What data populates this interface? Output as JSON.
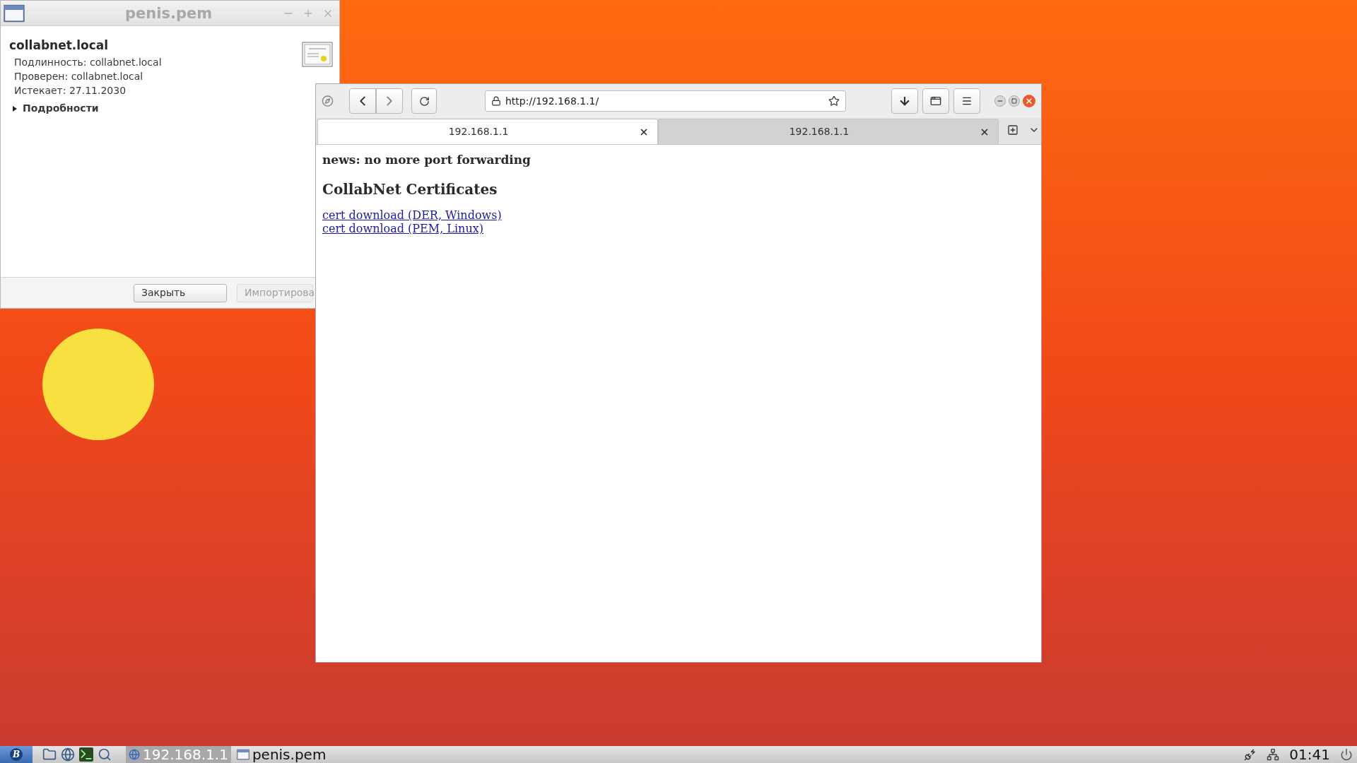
{
  "cert_window": {
    "title": "penis.pem",
    "subject": "collabnet.local",
    "fields": [
      "Подлинность: collabnet.local",
      "Проверен: collabnet.local",
      "Истекает: 27.11.2030"
    ],
    "details": {
      "label": "Подробности",
      "expanded": false
    },
    "buttons": [
      {
        "label": "Закрыть",
        "disabled": false
      },
      {
        "label": "Импортирова",
        "disabled": true
      }
    ]
  },
  "browser": {
    "url": "http://192.168.1.1/",
    "tabs": [
      {
        "title": "192.168.1.1",
        "selected": true
      },
      {
        "title": "192.168.1.1",
        "selected": false
      }
    ],
    "page": {
      "news": "news: no more port forwarding",
      "heading": "CollabNet Certificates",
      "links": [
        "cert download (DER, Windows)",
        "cert download (PEM, Linux)"
      ]
    }
  },
  "taskbar": {
    "start": "B",
    "tasks": [
      {
        "label": "192.168.1.1",
        "kind": "browser",
        "selected": true
      },
      {
        "label": "penis.pem",
        "kind": "window",
        "selected": false
      }
    ],
    "clock": "01:41"
  }
}
